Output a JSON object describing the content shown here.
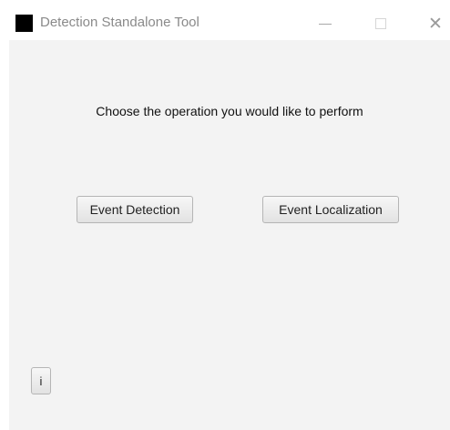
{
  "window": {
    "title": "Detection Standalone Tool",
    "controls": {
      "minimize_icon": "minimize-icon",
      "maximize_icon": "maximize-icon",
      "close_label": "✕"
    }
  },
  "main": {
    "prompt": "Choose the operation you would like to perform",
    "buttons": {
      "event_detection": "Event Detection",
      "event_localization": "Event Localization",
      "info": "i"
    }
  },
  "colors": {
    "content_bg": "#f3f3f3",
    "titlebar_bg": "#ffffff",
    "title_text": "#8a8a8a"
  }
}
